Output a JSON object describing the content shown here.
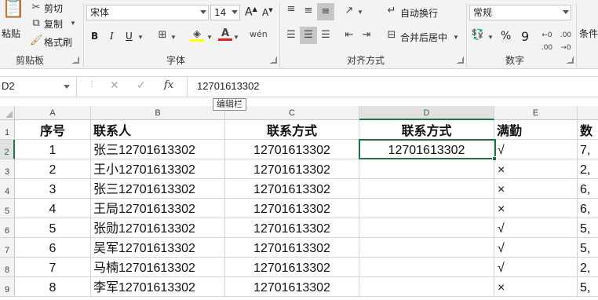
{
  "ribbon": {
    "clipboard": {
      "paste": "粘贴",
      "cut": "剪切",
      "copy": "复制",
      "format_painter": "格式刷",
      "label": "剪贴板"
    },
    "font": {
      "font_name": "宋体",
      "font_size": "14",
      "bold": "B",
      "italic": "I",
      "underline": "U",
      "grow": "A",
      "shrink": "A",
      "label": "字体"
    },
    "alignment": {
      "wrap_text": "自动换行",
      "merge_center": "合并后居中",
      "label": "对齐方式"
    },
    "number": {
      "format": "常规",
      "percent": "%",
      "comma": "9",
      "label": "数字"
    },
    "styles": {
      "label": "条件"
    }
  },
  "formula_bar": {
    "name_box": "D2",
    "value": "12701613302",
    "tooltip": "编辑栏",
    "fx": "fx"
  },
  "grid": {
    "row_numbers": [
      "1",
      "2",
      "3",
      "4",
      "5",
      "6",
      "7",
      "8",
      "9"
    ],
    "col_letters": [
      "A",
      "B",
      "C",
      "D",
      "E"
    ],
    "headers": [
      "序号",
      "联系人",
      "联系方式",
      "联系方式",
      "满勤",
      "数"
    ],
    "rows": [
      {
        "a": "1",
        "b": "张三12701613302",
        "c": "12701613302",
        "d": "12701613302",
        "e": "√",
        "f": "7,"
      },
      {
        "a": "2",
        "b": "王小12701613302",
        "c": "12701613302",
        "d": "",
        "e": "×",
        "f": "2,"
      },
      {
        "a": "3",
        "b": "张三12701613302",
        "c": "12701613302",
        "d": "",
        "e": "×",
        "f": "6,"
      },
      {
        "a": "4",
        "b": "王局12701613302",
        "c": "12701613302",
        "d": "",
        "e": "×",
        "f": "6,"
      },
      {
        "a": "5",
        "b": "张勋12701613302",
        "c": "12701613302",
        "d": "",
        "e": "√",
        "f": "5,"
      },
      {
        "a": "6",
        "b": "吴军12701613302",
        "c": "12701613302",
        "d": "",
        "e": "√",
        "f": "5,"
      },
      {
        "a": "7",
        "b": "马楠12701613302",
        "c": "12701613302",
        "d": "",
        "e": "√",
        "f": "2,"
      },
      {
        "a": "8",
        "b": "李军12701613302",
        "c": "12701613302",
        "d": "",
        "e": "×",
        "f": "5,"
      }
    ]
  },
  "colors": {
    "accent": "#217346"
  }
}
